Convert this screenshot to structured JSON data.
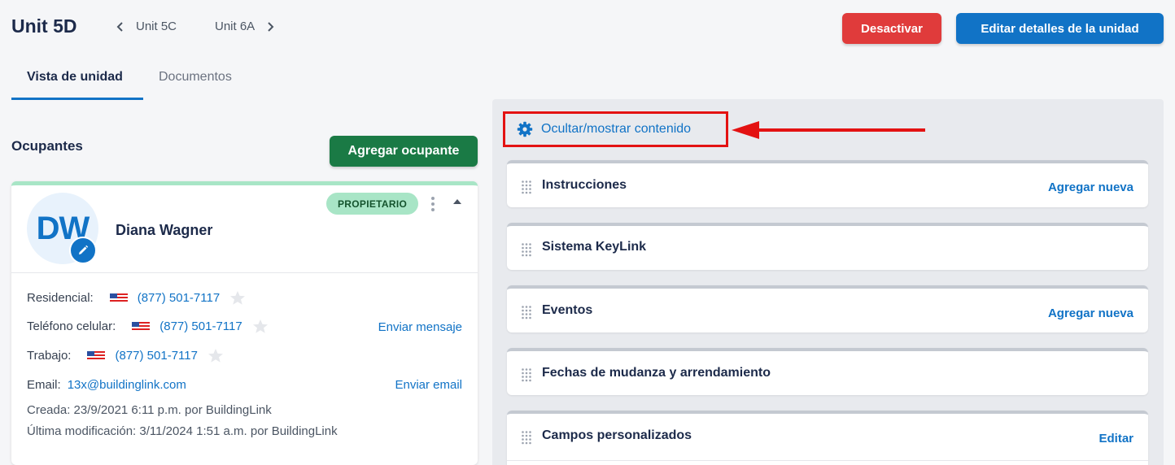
{
  "header": {
    "title": "Unit 5D",
    "prev_unit": "Unit 5C",
    "next_unit": "Unit 6A",
    "deactivate_label": "Desactivar",
    "edit_label": "Editar detalles de la unidad"
  },
  "tabs": [
    {
      "label": "Vista de unidad",
      "active": true
    },
    {
      "label": "Documentos",
      "active": false
    }
  ],
  "occupants": {
    "title": "Ocupantes",
    "add_label": "Agregar ocupante",
    "card": {
      "initials": "DW",
      "name": "Diana Wagner",
      "badge": "PROPIETARIO",
      "phones": [
        {
          "label": "Residencial:",
          "number": "(877) 501-7117"
        },
        {
          "label": "Teléfono celular:",
          "number": "(877) 501-7117",
          "action": "Enviar mensaje"
        },
        {
          "label": "Trabajo:",
          "number": "(877) 501-7117"
        }
      ],
      "email_label": "Email:",
      "email": "13x@buildinglink.com",
      "email_action": "Enviar email",
      "created": "Creada:  23/9/2021 6:11 p.m. por BuildingLink",
      "modified": "Última modificación:  3/11/2024 1:51 a.m. por BuildingLink"
    }
  },
  "content": {
    "toggle_label": "Ocultar/mostrar contenido",
    "panels": [
      {
        "title": "Instrucciones",
        "action": "Agregar nueva"
      },
      {
        "title": "Sistema KeyLink",
        "action": ""
      },
      {
        "title": "Eventos",
        "action": "Agregar nueva"
      },
      {
        "title": "Fechas de mudanza y arrendamiento",
        "action": ""
      },
      {
        "title": "Campos personalizados",
        "action": "Editar"
      }
    ]
  },
  "colors": {
    "primary": "#1173c6",
    "danger": "#e03b3b",
    "success": "#1a7a45",
    "badge": "#a8e5c6",
    "annotation": "#e31212"
  },
  "icons": [
    "chevron-left-icon",
    "chevron-right-icon",
    "pencil-icon",
    "kebab-icon",
    "caret-up-icon",
    "us-flag-icon",
    "star-icon",
    "gear-icon",
    "drag-handle-icon",
    "red-arrow-icon"
  ]
}
